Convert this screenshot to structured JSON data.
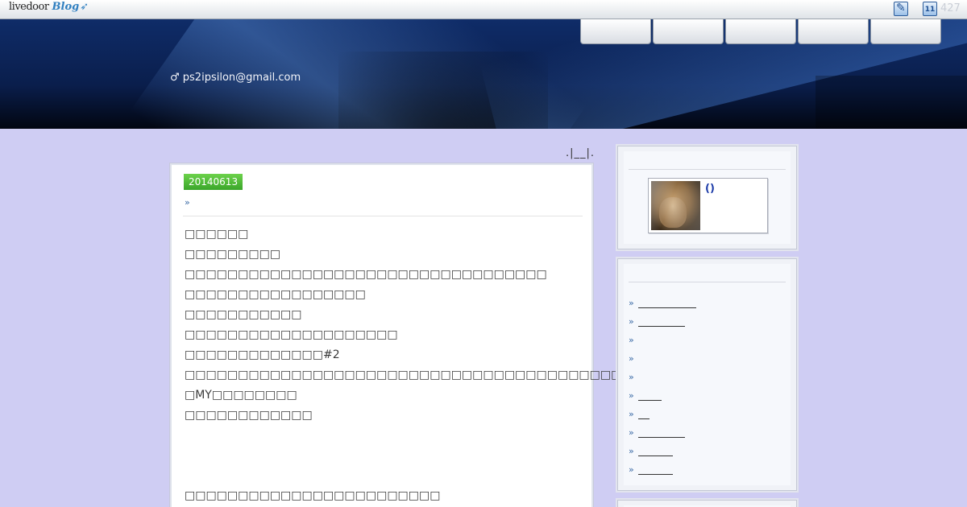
{
  "topbar": {
    "logo_livedoor": "livedoor",
    "logo_blog": "Blog",
    "edit_icon": "edit-icon",
    "calendar_icon": "calendar-icon",
    "calendar_day": "11",
    "count": "427"
  },
  "header": {
    "subtitle": "♂ ps2ipsilon@gmail.com",
    "nav_tabs": [
      "",
      "",
      "",
      "",
      ""
    ]
  },
  "main": {
    "pager": ".|__|.",
    "article": {
      "date": "20140613",
      "title_bullet": "»",
      "lines": [
        "□□□□□□",
        "□□□□□□□□□",
        "□□□□□□□□□□□□□□□□□□□□□□□□□□□□□□□□□□",
        "□□□□□□□□□□□□□□□□□",
        "□□□□□□□□□□□",
        "□□□□□□□□□□□□□□□□□□□□",
        "□□□□□□□□□□□□□#2",
        "□□□□□□□□□□□□□□□□□□□□□□□□□□□□□□□□□□□□□□□□□□",
        "□MY□□□□□□□□",
        "□□□□□□□□□□□□",
        "□□□□□□□□□□□□□□□□□□□□□□□□"
      ]
    }
  },
  "sidebar": {
    "profile": {
      "name": "()",
      "avatar": "profile-photo"
    },
    "links": [
      {
        "label": "",
        "width": 72
      },
      {
        "label": "",
        "width": 58
      },
      {
        "label": "",
        "width": 0
      },
      {
        "label": "",
        "width": 0
      },
      {
        "label": "",
        "width": 0
      },
      {
        "label": "",
        "width": 29
      },
      {
        "label": "",
        "width": 14
      },
      {
        "label": "",
        "width": 58
      },
      {
        "label": "",
        "width": 43
      },
      {
        "label": "",
        "width": 43
      }
    ]
  },
  "colors": {
    "page_background": "#cfcdf3",
    "date_badge": "#4fbf35",
    "link_blue": "#1b3aa8",
    "header_navy": "#0f2c68"
  }
}
